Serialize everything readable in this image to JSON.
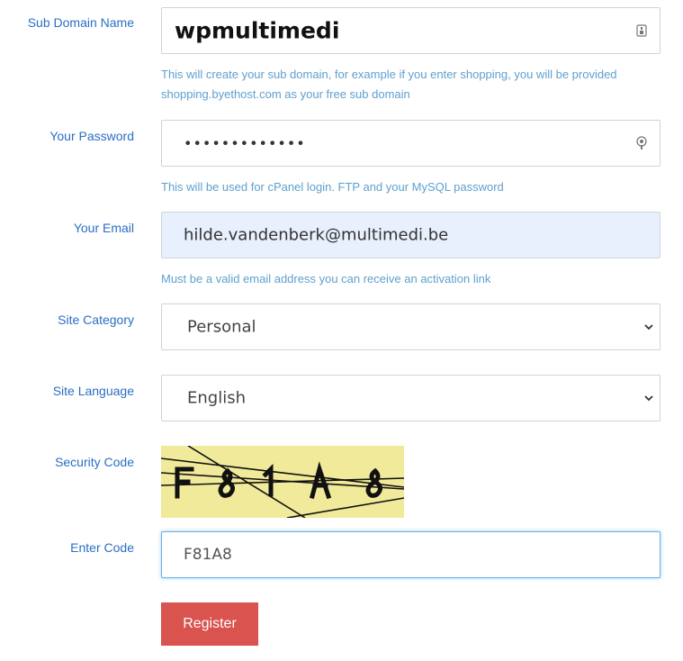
{
  "subdomain": {
    "label": "Sub Domain Name",
    "value": "wpmultimedi",
    "help": "This will create your sub domain, for example if you enter shopping, you will be provided shopping.byethost.com as your free sub domain"
  },
  "password": {
    "label": "Your Password",
    "value": "•••••••••••••",
    "help": "This will be used for cPanel login. FTP and your MySQL password"
  },
  "email": {
    "label": "Your Email",
    "value": "hilde.vandenberk@multimedi.be",
    "help": "Must be a valid email address you can receive an activation link"
  },
  "category": {
    "label": "Site Category",
    "selected": "Personal"
  },
  "language": {
    "label": "Site Language",
    "selected": "English"
  },
  "security": {
    "label": "Security Code",
    "captcha_text": "F81A8"
  },
  "enter_code": {
    "label": "Enter Code",
    "value": "F81A8"
  },
  "register": {
    "label": "Register"
  },
  "colors": {
    "label_blue": "#2a6fc4",
    "help_blue": "#5fa0cf",
    "email_autofill_bg": "#e8f0fe",
    "focus_border": "#66afe9",
    "register_red": "#d9534f",
    "captcha_bg": "#f0ea9a"
  }
}
